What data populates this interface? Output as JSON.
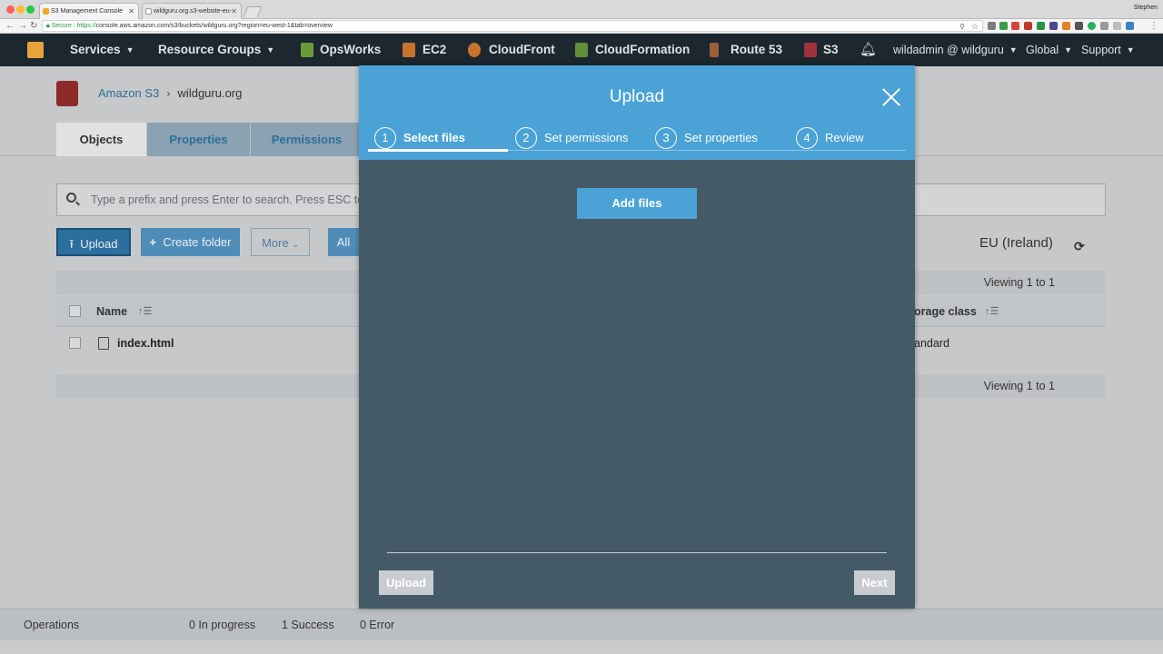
{
  "browser": {
    "tabs": [
      {
        "title": "S3 Management Console",
        "active": true
      },
      {
        "title": "wildguru.org.s3-website-eu-",
        "active": false
      }
    ],
    "profile_name": "Stephen",
    "url_secure_label": "Secure",
    "url_scheme": "https://",
    "url_rest": "console.aws.amazon.com/s3/buckets/wildguru.org?region=eu-west-1&tab=overview"
  },
  "aws_nav": {
    "services": "Services",
    "resource_groups": "Resource Groups",
    "shortcuts": [
      "OpsWorks",
      "EC2",
      "CloudFront",
      "CloudFormation",
      "Route 53",
      "S3"
    ],
    "account": "wildadmin @ wildguru",
    "region": "Global",
    "support": "Support"
  },
  "breadcrumb": {
    "root": "Amazon S3",
    "current": "wildguru.org"
  },
  "page_tabs": [
    "Objects",
    "Properties",
    "Permissions"
  ],
  "search": {
    "placeholder": "Type a prefix and press Enter to search. Press ESC to"
  },
  "toolbar": {
    "upload": "Upload",
    "create_folder": "Create folder",
    "more": "More",
    "all": "All"
  },
  "region_label": "EU (Ireland)",
  "viewing_label": "Viewing 1 to 1",
  "table": {
    "columns": {
      "name": "Name",
      "storage_class": "orage class"
    },
    "rows": [
      {
        "name": "index.html",
        "storage_class": "andard"
      }
    ]
  },
  "status_bar": {
    "operations": "Operations",
    "in_progress": "0 In progress",
    "success": "1 Success",
    "error": "0 Error"
  },
  "modal": {
    "title": "Upload",
    "steps": [
      {
        "num": "1",
        "label": "Select files"
      },
      {
        "num": "2",
        "label": "Set permissions"
      },
      {
        "num": "3",
        "label": "Set properties"
      },
      {
        "num": "4",
        "label": "Review"
      }
    ],
    "active_step": "1",
    "add_files": "Add files",
    "upload_btn": "Upload",
    "next_btn": "Next"
  },
  "colors": {
    "modal_header": "#4aa2d6",
    "modal_body": "#455a67",
    "aws_nav": "#1d272f"
  }
}
